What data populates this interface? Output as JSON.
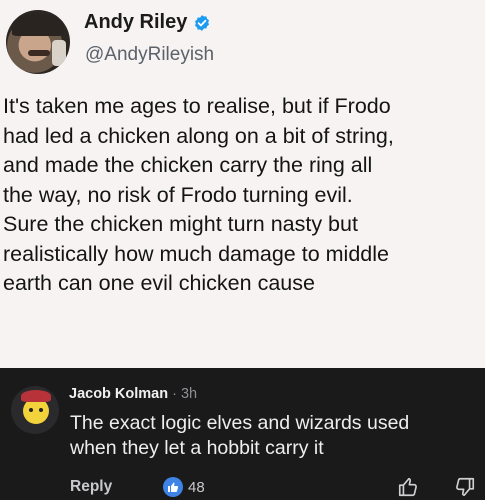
{
  "tweet": {
    "author_name": "Andy Riley",
    "handle": "@AndyRileyish",
    "verified": true,
    "body_lines": [
      "It's taken me ages to realise, but if Frodo",
      "had led a chicken along on a bit of string,",
      "and made the chicken carry the ring all",
      "the way, no risk of Frodo turning evil.",
      "Sure the chicken might turn nasty but",
      "realistically how much damage to middle",
      "earth can one evil chicken cause"
    ]
  },
  "comment": {
    "author": "Jacob Kolman",
    "separator": "·",
    "time": "3h",
    "text_lines": [
      "The exact logic elves and wizards used",
      "when they let a hobbit carry it"
    ],
    "reply_label": "Reply",
    "like_count": "48"
  },
  "icons": {
    "verified": "verified-badge-icon",
    "like_badge": "thumbs-up-badge-icon",
    "thumb_up": "thumbs-up-outline-icon",
    "thumb_down": "thumbs-down-outline-icon"
  },
  "colors": {
    "tweet_bg": "#f7f3f3",
    "comment_bg": "#1a1a1b",
    "verified_blue": "#1d9bf0",
    "like_blue": "#3d84e6"
  }
}
